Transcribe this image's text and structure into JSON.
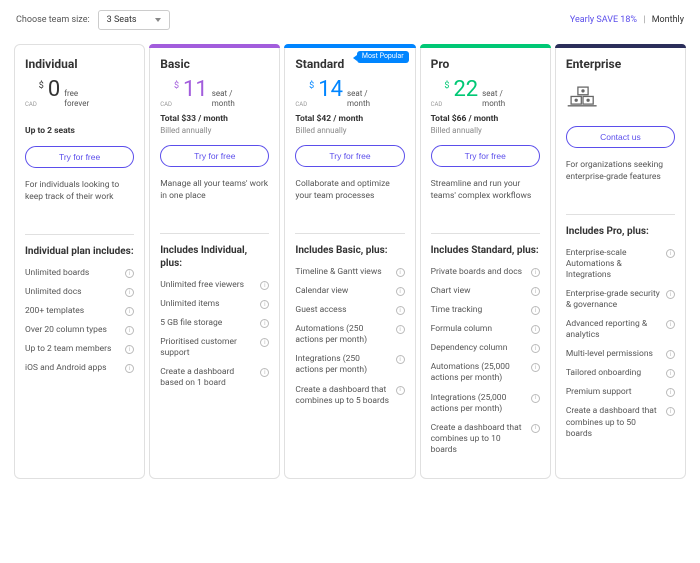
{
  "topbar": {
    "team_label": "Choose team size:",
    "team_value": "3 Seats",
    "yearly": "Yearly SAVE 18%",
    "monthly": "Monthly"
  },
  "plans": {
    "individual": {
      "name": "Individual",
      "currency": "$",
      "amount": "0",
      "cad": "CAD",
      "unit1": "free",
      "unit2": "forever",
      "seats": "Up to 2 seats",
      "cta": "Try for free",
      "desc": "For individuals looking to keep track of their work",
      "includes_title": "Individual plan includes:",
      "features": [
        "Unlimited boards",
        "Unlimited docs",
        "200+ templates",
        "Over 20 column types",
        "Up to 2 team members",
        "iOS and Android apps"
      ]
    },
    "basic": {
      "name": "Basic",
      "currency": "$",
      "amount": "11",
      "cad": "CAD",
      "unit1": "seat /",
      "unit2": "month",
      "total": "Total $33 / month",
      "billed": "Billed annually",
      "cta": "Try for free",
      "desc": "Manage all your teams' work in one place",
      "includes_title": "Includes Individual, plus:",
      "features": [
        "Unlimited free viewers",
        "Unlimited items",
        "5 GB file storage",
        "Prioritised customer support",
        "Create a dashboard based on 1 board"
      ]
    },
    "standard": {
      "name": "Standard",
      "badge": "Most Popular",
      "currency": "$",
      "amount": "14",
      "cad": "CAD",
      "unit1": "seat /",
      "unit2": "month",
      "total": "Total $42 / month",
      "billed": "Billed annually",
      "cta": "Try for free",
      "desc": "Collaborate and optimize your team processes",
      "includes_title": "Includes Basic, plus:",
      "features": [
        "Timeline & Gantt views",
        "Calendar view",
        "Guest access",
        "Automations (250 actions per month)",
        "Integrations (250 actions per month)",
        "Create a dashboard that combines up to 5 boards"
      ]
    },
    "pro": {
      "name": "Pro",
      "currency": "$",
      "amount": "22",
      "cad": "CAD",
      "unit1": "seat /",
      "unit2": "month",
      "total": "Total $66 / month",
      "billed": "Billed annually",
      "cta": "Try for free",
      "desc": "Streamline and run your teams' complex workflows",
      "includes_title": "Includes Standard, plus:",
      "features": [
        "Private boards and docs",
        "Chart view",
        "Time tracking",
        "Formula column",
        "Dependency column",
        "Automations (25,000 actions per month)",
        "Integrations (25,000 actions per month)",
        "Create a dashboard that combines up to 10 boards"
      ]
    },
    "enterprise": {
      "name": "Enterprise",
      "cta": "Contact us",
      "desc": "For organizations seeking enterprise-grade features",
      "includes_title": "Includes Pro, plus:",
      "features": [
        "Enterprise-scale Automations & Integrations",
        "Enterprise-grade security & governance",
        "Advanced reporting & analytics",
        "Multi-level permissions",
        "Tailored onboarding",
        "Premium support",
        "Create a dashboard that combines up to 50 boards"
      ]
    }
  }
}
